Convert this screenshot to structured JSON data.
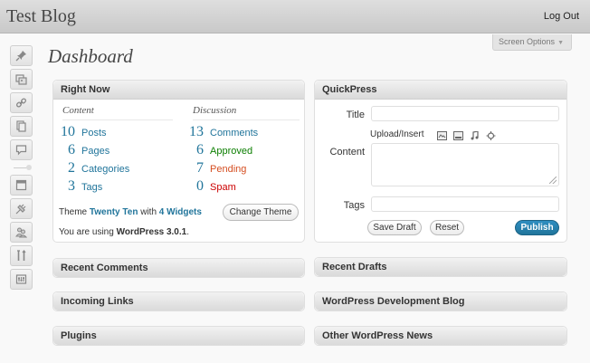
{
  "header": {
    "site_title": "Test Blog",
    "logout": "Log Out"
  },
  "screen_options": {
    "label": "Screen Options",
    "arrow": "▼"
  },
  "sidebar": {
    "groups": [
      [
        "pin-icon",
        "media-icon",
        "link-icon",
        "pages-icon",
        "comments-icon"
      ],
      [
        "appearance-icon",
        "plugins-icon",
        "users-icon",
        "tools-icon",
        "settings-icon"
      ]
    ]
  },
  "page_title": "Dashboard",
  "right_now": {
    "title": "Right Now",
    "content_heading": "Content",
    "discussion_heading": "Discussion",
    "content": [
      {
        "count": "10",
        "label": "Posts"
      },
      {
        "count": "6",
        "label": "Pages"
      },
      {
        "count": "2",
        "label": "Categories"
      },
      {
        "count": "3",
        "label": "Tags"
      }
    ],
    "discussion": [
      {
        "count": "13",
        "label": "Comments",
        "status": "normal"
      },
      {
        "count": "6",
        "label": "Approved",
        "status": "approved"
      },
      {
        "count": "7",
        "label": "Pending",
        "status": "pending"
      },
      {
        "count": "0",
        "label": "Spam",
        "status": "spam"
      }
    ],
    "theme_prefix": "Theme",
    "theme_name": "Twenty Ten",
    "theme_with": "with",
    "widgets": "4 Widgets",
    "change_theme": "Change Theme",
    "version_prefix": "You are using",
    "version": "WordPress 3.0.1",
    "version_suffix": "."
  },
  "quickpress": {
    "title": "QuickPress",
    "title_label": "Title",
    "title_value": "",
    "upload_label": "Upload/Insert",
    "upload_icons": [
      "image-icon",
      "video-icon",
      "audio-icon",
      "media-star-icon"
    ],
    "content_label": "Content",
    "content_value": "",
    "tags_label": "Tags",
    "tags_value": "",
    "save_draft": "Save Draft",
    "reset": "Reset",
    "publish": "Publish"
  },
  "left_boxes": [
    "Recent Comments",
    "Incoming Links",
    "Plugins"
  ],
  "right_boxes": [
    "Recent Drafts",
    "WordPress Development Blog",
    "Other WordPress News"
  ],
  "colors": {
    "link": "#21759b",
    "approved": "#0b7e00",
    "pending": "#d54e21",
    "spam": "#cc0000",
    "publish": "#21759b"
  }
}
